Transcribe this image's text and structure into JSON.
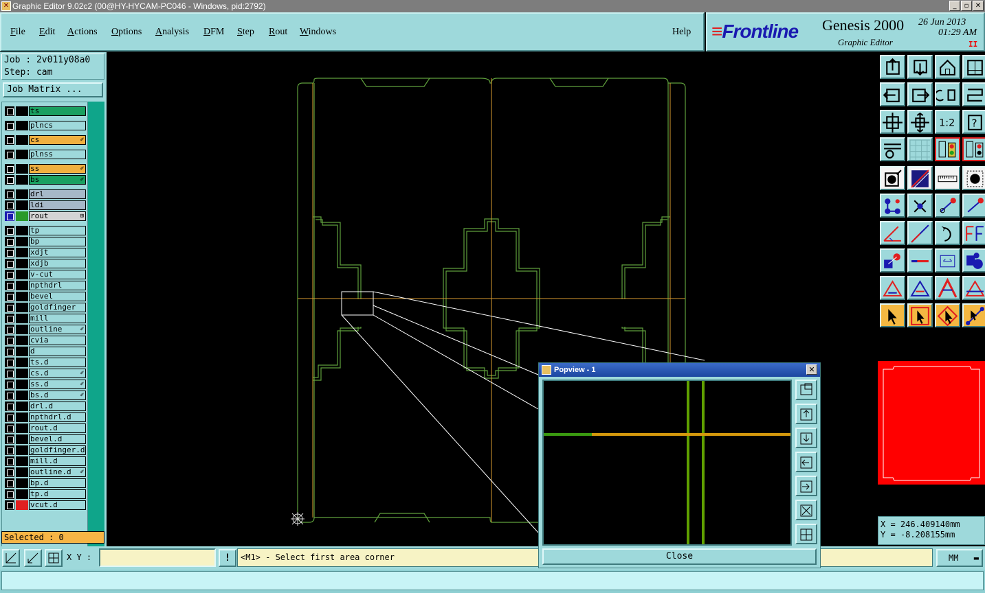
{
  "window": {
    "title": "Graphic Editor 9.02c2 (00@HY-HYCAM-PC046 - Windows, pid:2792)",
    "min": "_",
    "restore": "▫",
    "close": "✕"
  },
  "menu": {
    "file": {
      "u": "F",
      "rest": "ile"
    },
    "edit": {
      "u": "E",
      "rest": "dit"
    },
    "actions": {
      "u": "A",
      "rest": "ctions"
    },
    "options": {
      "u": "O",
      "rest": "ptions"
    },
    "analysis": {
      "u": "A",
      "rest": "nalysis"
    },
    "dfm": {
      "u": "D",
      "rest": "FM"
    },
    "step": {
      "u": "S",
      "rest": "tep"
    },
    "rout": {
      "u": "R",
      "rest": "out"
    },
    "windows": {
      "u": "W",
      "rest": "indows"
    },
    "help": "Help"
  },
  "brand": {
    "logo": "Frontline",
    "product": "Genesis 2000",
    "subtitle": "Graphic Editor",
    "date": "26 Jun 2013",
    "time": "01:29  AM",
    "pause": "II"
  },
  "job": {
    "job_line": "Job : 2v011y08a0",
    "step_line": "Step: cam",
    "matrix_button": "Job Matrix ..."
  },
  "layers": [
    {
      "name": "ts",
      "style": "green",
      "swatch": "#000000",
      "mark": ""
    },
    {
      "name": "plncs",
      "style": "",
      "swatch": "#000000",
      "mark": ""
    },
    {
      "name": "cs",
      "style": "orange",
      "swatch": "#000000",
      "mark": "✐"
    },
    {
      "name": "plnss",
      "style": "",
      "swatch": "#000000",
      "mark": ""
    },
    {
      "name": "ss",
      "style": "orange",
      "swatch": "#000000",
      "mark": "✐"
    },
    {
      "name": "bs",
      "style": "green",
      "swatch": "#000000",
      "mark": "✐"
    },
    {
      "name": "drl",
      "style": "grey",
      "swatch": "#000000",
      "mark": ""
    },
    {
      "name": "ldi",
      "style": "grey",
      "swatch": "#000000",
      "mark": ""
    },
    {
      "name": "rout",
      "style": "rout",
      "swatch": "#2a9a2a",
      "mark": "⊞"
    },
    {
      "name": "tp",
      "style": "",
      "swatch": "#000000",
      "mark": ""
    },
    {
      "name": "bp",
      "style": "",
      "swatch": "#000000",
      "mark": ""
    },
    {
      "name": "xdjt",
      "style": "",
      "swatch": "#000000",
      "mark": ""
    },
    {
      "name": "xdjb",
      "style": "",
      "swatch": "#000000",
      "mark": ""
    },
    {
      "name": "v-cut",
      "style": "",
      "swatch": "#000000",
      "mark": ""
    },
    {
      "name": "npthdrl",
      "style": "",
      "swatch": "#000000",
      "mark": ""
    },
    {
      "name": "bevel",
      "style": "",
      "swatch": "#000000",
      "mark": ""
    },
    {
      "name": "goldfinger",
      "style": "",
      "swatch": "#000000",
      "mark": ""
    },
    {
      "name": "mill",
      "style": "",
      "swatch": "#000000",
      "mark": ""
    },
    {
      "name": "outline",
      "style": "",
      "swatch": "#000000",
      "mark": "✐"
    },
    {
      "name": "cvia",
      "style": "",
      "swatch": "#000000",
      "mark": ""
    },
    {
      "name": "d",
      "style": "",
      "swatch": "#000000",
      "mark": ""
    },
    {
      "name": "ts.d",
      "style": "",
      "swatch": "#000000",
      "mark": ""
    },
    {
      "name": "cs.d",
      "style": "",
      "swatch": "#000000",
      "mark": "✐"
    },
    {
      "name": "ss.d",
      "style": "",
      "swatch": "#000000",
      "mark": "✐"
    },
    {
      "name": "bs.d",
      "style": "",
      "swatch": "#000000",
      "mark": "✐"
    },
    {
      "name": "drl.d",
      "style": "",
      "swatch": "#000000",
      "mark": ""
    },
    {
      "name": "npthdrl.d",
      "style": "",
      "swatch": "#000000",
      "mark": ""
    },
    {
      "name": "rout.d",
      "style": "",
      "swatch": "#000000",
      "mark": ""
    },
    {
      "name": "bevel.d",
      "style": "",
      "swatch": "#000000",
      "mark": ""
    },
    {
      "name": "goldfinger.d",
      "style": "",
      "swatch": "#000000",
      "mark": ""
    },
    {
      "name": "mill.d",
      "style": "",
      "swatch": "#000000",
      "mark": ""
    },
    {
      "name": "outline.d",
      "style": "",
      "swatch": "#000000",
      "mark": "✐"
    },
    {
      "name": "bp.d",
      "style": "",
      "swatch": "#000000",
      "mark": ""
    },
    {
      "name": "tp.d",
      "style": "",
      "swatch": "#000000",
      "mark": ""
    },
    {
      "name": "vcut.d",
      "style": "",
      "swatch": "#e02020",
      "mark": ""
    }
  ],
  "selected": "Selected : 0",
  "bottom": {
    "xy_label": "X Y :",
    "xy_value": "",
    "alert": "!",
    "message": "<M1> - Select first area corner",
    "units": "MM"
  },
  "coords": {
    "x": "X  = 246.409140mm",
    "y": "Y  = -8.208155mm"
  },
  "popview": {
    "title": "Popview - 1",
    "close_label": "Close",
    "x": "✕"
  },
  "toolbar_text": {
    "ratio": "1:2",
    "help": "?"
  },
  "colors": {
    "panel": "#9ed9db",
    "profile": "#5fa03c",
    "datum": "#d89a30",
    "selection": "#ffffff"
  }
}
